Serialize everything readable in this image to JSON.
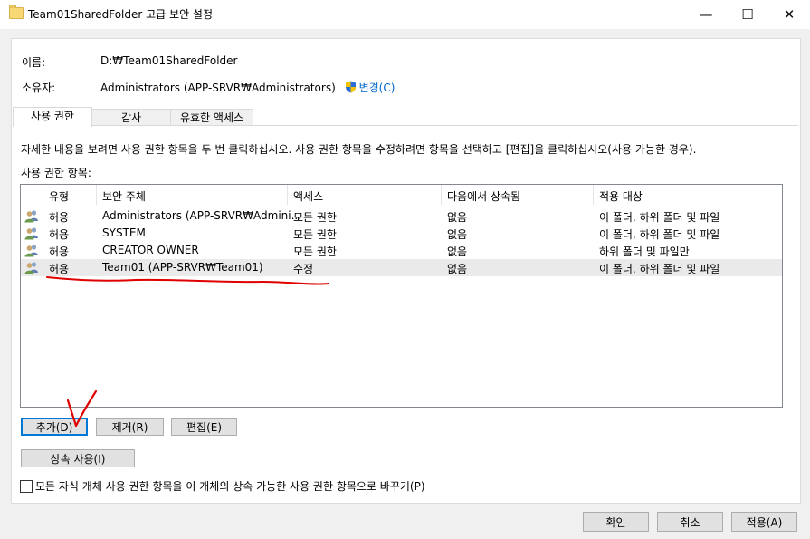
{
  "window": {
    "title": "Team01SharedFolder 고급 보안 설정",
    "minimize": "—",
    "maximize": "☐",
    "close": "✕"
  },
  "info": {
    "name_label": "이름:",
    "name_value": "D:₩Team01SharedFolder",
    "owner_label": "소유자:",
    "owner_value": "Administrators (APP-SRVR₩Administrators)",
    "change_link": "변경(C)"
  },
  "tabs": [
    {
      "label": "사용 권한",
      "active": true
    },
    {
      "label": "감사",
      "active": false
    },
    {
      "label": "유효한 액세스",
      "active": false
    }
  ],
  "description": "자세한 내용을 보려면 사용 권한 항목을 두 번 클릭하십시오. 사용 권한 항목을 수정하려면 항목을 선택하고 [편집]을 클릭하십시오(사용 가능한 경우).",
  "entries_label": "사용 권한 항목:",
  "table": {
    "columns": [
      "유형",
      "보안 주체",
      "액세스",
      "다음에서 상속됨",
      "적용 대상"
    ],
    "rows": [
      {
        "type": "허용",
        "principal": "Administrators (APP-SRVR₩Admini...",
        "access": "모든 권한",
        "inherited": "없음",
        "applies": "이 폴더, 하위 폴더 및 파일"
      },
      {
        "type": "허용",
        "principal": "SYSTEM",
        "access": "모든 권한",
        "inherited": "없음",
        "applies": "이 폴더, 하위 폴더 및 파일"
      },
      {
        "type": "허용",
        "principal": "CREATOR OWNER",
        "access": "모든 권한",
        "inherited": "없음",
        "applies": "하위 폴더 및 파일만"
      },
      {
        "type": "허용",
        "principal": "Team01 (APP-SRVR₩Team01)",
        "access": "수정",
        "inherited": "없음",
        "applies": "이 폴더, 하위 폴더 및 파일"
      }
    ]
  },
  "buttons": {
    "add": "추가(D)",
    "remove": "제거(R)",
    "edit": "편집(E)",
    "enable_inheritance": "상속 사용(I)",
    "ok": "확인",
    "cancel": "취소",
    "apply": "적용(A)"
  },
  "replace_checkbox": {
    "label": "모든 자식 개체 사용 권한 항목을 이 개체의 상속 가능한 사용 권한 항목으로 바꾸기(P)",
    "checked": false
  },
  "colors": {
    "annotation": "#e00000",
    "link": "#0066cc",
    "selected_row": "#eaeaea"
  }
}
